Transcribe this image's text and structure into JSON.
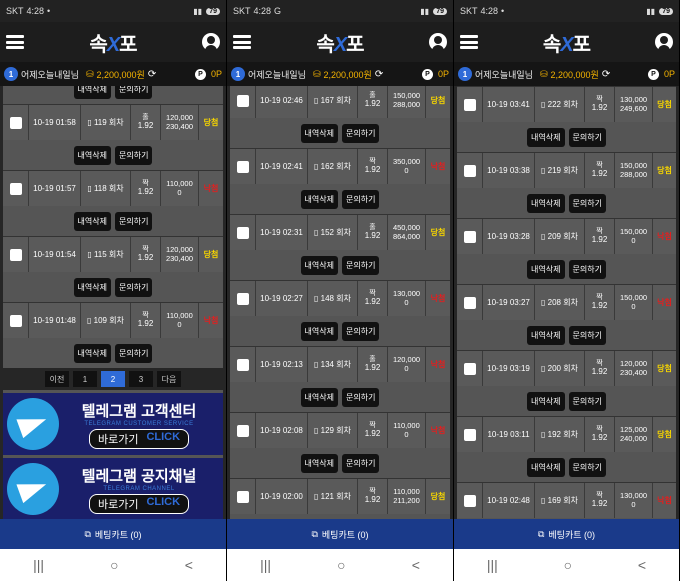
{
  "status": {
    "carrier": "SKT",
    "time": "4:28",
    "battery": "79",
    "g_label": "G",
    "dot": "•"
  },
  "app": {
    "logo_left": "속",
    "logo_x": "X",
    "logo_right": "포"
  },
  "user": {
    "level": "1",
    "name": "어제오늘내일님",
    "money": "2,200,000원",
    "points": "0P",
    "point_icon": "P"
  },
  "actions": {
    "delete": "내역삭제",
    "inquiry": "문의하기"
  },
  "pager": {
    "prev": "이전",
    "pages": [
      "1",
      "2",
      "3"
    ],
    "next": "다음",
    "active": 1
  },
  "banners": [
    {
      "title": "텔레그램 고객센터",
      "sub": "TELEGRAM CUSTOMER SERVICE",
      "btn": "바로가기",
      "click": "CLICK"
    },
    {
      "title": "텔레그램 공지채널",
      "sub": "TELEGRAM CHANNEL",
      "btn": "바로가기",
      "click": "CLICK"
    }
  ],
  "cart": {
    "label": "베팅카트 (0)"
  },
  "nav": {
    "recent": "|||",
    "home": "○",
    "back": "<"
  },
  "colors": {
    "accent": "#2f6bd8",
    "money": "#f5b400",
    "win": "#f5d400",
    "lose": "#e02020"
  },
  "screens": [
    {
      "rows": [
        {
          "time": "10-19 01:58",
          "round": "119 회차",
          "pick": "홀",
          "odds": "1.92",
          "bet": "120,000",
          "payout": "230,400",
          "result": "당첨",
          "win": true
        },
        {
          "time": "10-19 01:57",
          "round": "118 회차",
          "pick": "짝",
          "odds": "1.92",
          "bet": "110,000",
          "payout": "0",
          "result": "낙첨",
          "win": false
        },
        {
          "time": "10-19 01:54",
          "round": "115 회차",
          "pick": "짝",
          "odds": "1.92",
          "bet": "120,000",
          "payout": "230,400",
          "result": "당첨",
          "win": true
        },
        {
          "time": "10-19 01:48",
          "round": "109 회차",
          "pick": "짝",
          "odds": "1.92",
          "bet": "110,000",
          "payout": "0",
          "result": "낙첨",
          "win": false
        }
      ]
    },
    {
      "rows": [
        {
          "time": "10-19 02:46",
          "round": "167 회차",
          "pick": "홀",
          "odds": "1.92",
          "bet": "150,000",
          "payout": "288,000",
          "result": "당첨",
          "win": true
        },
        {
          "time": "10-19 02:41",
          "round": "162 회차",
          "pick": "짝",
          "odds": "1.92",
          "bet": "350,000",
          "payout": "0",
          "result": "낙첨",
          "win": false
        },
        {
          "time": "10-19 02:31",
          "round": "152 회차",
          "pick": "홀",
          "odds": "1.92",
          "bet": "450,000",
          "payout": "864,000",
          "result": "당첨",
          "win": true
        },
        {
          "time": "10-19 02:27",
          "round": "148 회차",
          "pick": "짝",
          "odds": "1.92",
          "bet": "130,000",
          "payout": "0",
          "result": "낙첨",
          "win": false
        },
        {
          "time": "10-19 02:13",
          "round": "134 회차",
          "pick": "홀",
          "odds": "1.92",
          "bet": "120,000",
          "payout": "0",
          "result": "낙첨",
          "win": false
        },
        {
          "time": "10-19 02:08",
          "round": "129 회차",
          "pick": "짝",
          "odds": "1.92",
          "bet": "110,000",
          "payout": "0",
          "result": "낙첨",
          "win": false
        },
        {
          "time": "10-19 02:00",
          "round": "121 회차",
          "pick": "짝",
          "odds": "1.92",
          "bet": "110,000",
          "payout": "211,200",
          "result": "당첨",
          "win": true
        }
      ]
    },
    {
      "rows": [
        {
          "time": "10-19 03:41",
          "round": "222 회차",
          "pick": "짝",
          "odds": "1.92",
          "bet": "130,000",
          "payout": "249,600",
          "result": "당첨",
          "win": true
        },
        {
          "time": "10-19 03:38",
          "round": "219 회차",
          "pick": "짝",
          "odds": "1.92",
          "bet": "150,000",
          "payout": "288,000",
          "result": "당첨",
          "win": true
        },
        {
          "time": "10-19 03:28",
          "round": "209 회차",
          "pick": "짝",
          "odds": "1.92",
          "bet": "150,000",
          "payout": "0",
          "result": "낙첨",
          "win": false
        },
        {
          "time": "10-19 03:27",
          "round": "208 회차",
          "pick": "짝",
          "odds": "1.92",
          "bet": "150,000",
          "payout": "0",
          "result": "낙첨",
          "win": false
        },
        {
          "time": "10-19 03:19",
          "round": "200 회차",
          "pick": "짝",
          "odds": "1.92",
          "bet": "120,000",
          "payout": "230,400",
          "result": "당첨",
          "win": true
        },
        {
          "time": "10-19 03:11",
          "round": "192 회차",
          "pick": "짝",
          "odds": "1.92",
          "bet": "125,000",
          "payout": "240,000",
          "result": "당첨",
          "win": true
        },
        {
          "time": "10-19 02:48",
          "round": "169 회차",
          "pick": "짝",
          "odds": "1.92",
          "bet": "130,000",
          "payout": "0",
          "result": "낙첨",
          "win": false
        }
      ]
    }
  ]
}
